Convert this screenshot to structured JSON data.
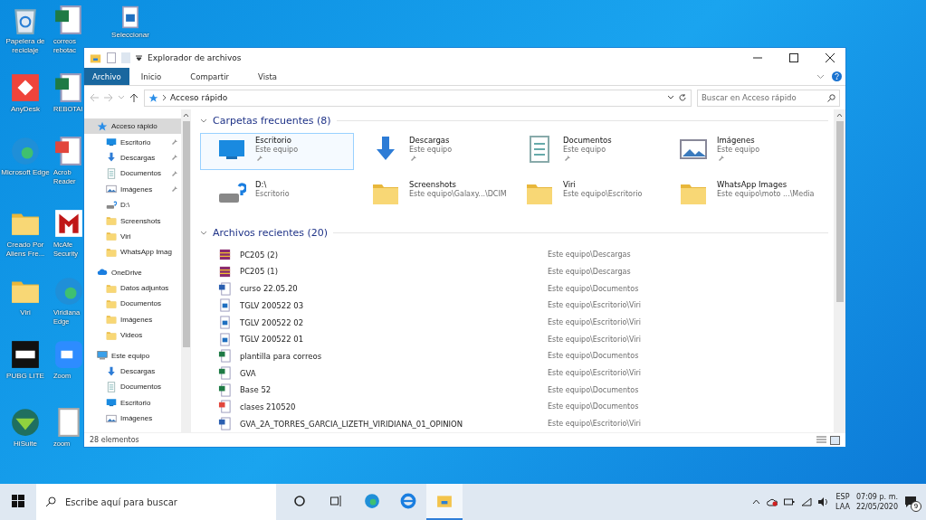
{
  "desktop_columns": [
    [
      {
        "label": "Papelera de reciclaje",
        "kind": "bin"
      },
      {
        "label": "AnyDesk",
        "kind": "anydesk"
      },
      {
        "label": "Microsoft Edge",
        "kind": "edge"
      },
      {
        "label": "Creado Por Aliens Fre...",
        "kind": "folder"
      },
      {
        "label": "Viri",
        "kind": "folder"
      },
      {
        "label": "PUBG LITE",
        "kind": "game"
      },
      {
        "label": "HiSuite",
        "kind": "hisuite"
      }
    ],
    [
      {
        "label": "correos rebotac",
        "kind": "excel"
      },
      {
        "label": "REBOTAI",
        "kind": "excel"
      },
      {
        "label": "Acrob Reader",
        "kind": "pdf"
      },
      {
        "label": "McAfe Security",
        "kind": "mcafee"
      },
      {
        "label": "Viridiana Edge",
        "kind": "edge"
      },
      {
        "label": "Zoom",
        "kind": "zoom"
      },
      {
        "label": "zoom",
        "kind": "doc"
      }
    ],
    [
      {
        "label": "Seleccionar",
        "kind": "image"
      }
    ]
  ],
  "window": {
    "title": "Explorador de archivos",
    "tabs": [
      {
        "label": "Archivo",
        "selected": true
      },
      {
        "label": "Inicio",
        "selected": false
      },
      {
        "label": "Compartir",
        "selected": false
      },
      {
        "label": "Vista",
        "selected": false
      }
    ],
    "address": "Acceso rápido",
    "search": {
      "placeholder": "Buscar en Acceso rápido"
    },
    "nav": [
      {
        "label": "Acceso rápido",
        "kind": "star",
        "selected": true,
        "children": [
          {
            "label": "Escritorio",
            "kind": "desktop",
            "pinned": true
          },
          {
            "label": "Descargas",
            "kind": "download",
            "pinned": true
          },
          {
            "label": "Documentos",
            "kind": "documents",
            "pinned": true
          },
          {
            "label": "Imágenes",
            "kind": "pictures",
            "pinned": true
          },
          {
            "label": "D:\\",
            "kind": "drive",
            "pinned": false
          },
          {
            "label": "Screenshots",
            "kind": "folder",
            "pinned": false
          },
          {
            "label": "Viri",
            "kind": "folder",
            "pinned": false
          },
          {
            "label": "WhatsApp Imag",
            "kind": "folder",
            "pinned": false
          }
        ]
      },
      {
        "label": "OneDrive",
        "kind": "cloud",
        "selected": false,
        "children": [
          {
            "label": "Datos adjuntos",
            "kind": "folder",
            "pinned": false
          },
          {
            "label": "Documentos",
            "kind": "folder",
            "pinned": false
          },
          {
            "label": "Imágenes",
            "kind": "folder",
            "pinned": false
          },
          {
            "label": "Videos",
            "kind": "folder",
            "pinned": false
          }
        ]
      },
      {
        "label": "Este equipo",
        "kind": "pc",
        "selected": false,
        "children": [
          {
            "label": "Descargas",
            "kind": "download",
            "pinned": false
          },
          {
            "label": "Documentos",
            "kind": "documents",
            "pinned": false
          },
          {
            "label": "Escritorio",
            "kind": "desktop",
            "pinned": false
          },
          {
            "label": "Imágenes",
            "kind": "pictures",
            "pinned": false
          }
        ]
      }
    ],
    "frequent": {
      "title": "Carpetas frecuentes (8)",
      "items": [
        {
          "name": "Escritorio",
          "location": "Este equipo",
          "kind": "desktop",
          "pinned": true,
          "selected": true
        },
        {
          "name": "Descargas",
          "location": "Este equipo",
          "kind": "download",
          "pinned": true,
          "selected": false
        },
        {
          "name": "Documentos",
          "location": "Este equipo",
          "kind": "documents",
          "pinned": true,
          "selected": false
        },
        {
          "name": "Imágenes",
          "location": "Este equipo",
          "kind": "pictures",
          "pinned": true,
          "selected": false
        },
        {
          "name": "D:\\",
          "location": "Escritorio",
          "kind": "drive",
          "pinned": false,
          "selected": false
        },
        {
          "name": "Screenshots",
          "location": "Este equipo\\Galaxy...\\DCIM",
          "kind": "folder",
          "pinned": false,
          "selected": false
        },
        {
          "name": "Viri",
          "location": "Este equipo\\Escritorio",
          "kind": "folder",
          "pinned": false,
          "selected": false
        },
        {
          "name": "WhatsApp Images",
          "location": "Este equipo\\moto ...\\Media",
          "kind": "folder",
          "pinned": false,
          "selected": false
        }
      ]
    },
    "recent": {
      "title": "Archivos recientes (20)",
      "items": [
        {
          "name": "PC205 (2)",
          "location": "Este equipo\\Descargas",
          "kind": "archive"
        },
        {
          "name": "PC205 (1)",
          "location": "Este equipo\\Descargas",
          "kind": "archive"
        },
        {
          "name": "curso 22.05.20",
          "location": "Este equipo\\Documentos",
          "kind": "word"
        },
        {
          "name": "TGLV 200522 03",
          "location": "Este equipo\\Escritorio\\Viri",
          "kind": "image"
        },
        {
          "name": "TGLV 200522 02",
          "location": "Este equipo\\Escritorio\\Viri",
          "kind": "image"
        },
        {
          "name": "TGLV 200522 01",
          "location": "Este equipo\\Escritorio\\Viri",
          "kind": "image"
        },
        {
          "name": "plantilla para correos",
          "location": "Este equipo\\Documentos",
          "kind": "excel"
        },
        {
          "name": "GVA",
          "location": "Este equipo\\Escritorio\\Viri",
          "kind": "excel"
        },
        {
          "name": "Base 52",
          "location": "Este equipo\\Documentos",
          "kind": "excel"
        },
        {
          "name": "clases 210520",
          "location": "Este equipo\\Documentos",
          "kind": "pdf"
        },
        {
          "name": "GVA_2A_TORRES_GARCIA_LIZETH_VIRIDIANA_01_OPINION",
          "location": "Este equipo\\Escritorio\\Viri",
          "kind": "word"
        }
      ]
    },
    "status": "28 elementos"
  },
  "taskbar": {
    "search": {
      "placeholder": "Escribe aquí para buscar"
    },
    "apps": [
      {
        "kind": "edge",
        "active": false
      },
      {
        "kind": "ie",
        "active": false
      },
      {
        "kind": "explorer",
        "active": true
      }
    ],
    "language": "ESP",
    "layout": "LAA",
    "time": "07:09 p. m.",
    "date": "22/05/2020",
    "notifications": "9"
  }
}
